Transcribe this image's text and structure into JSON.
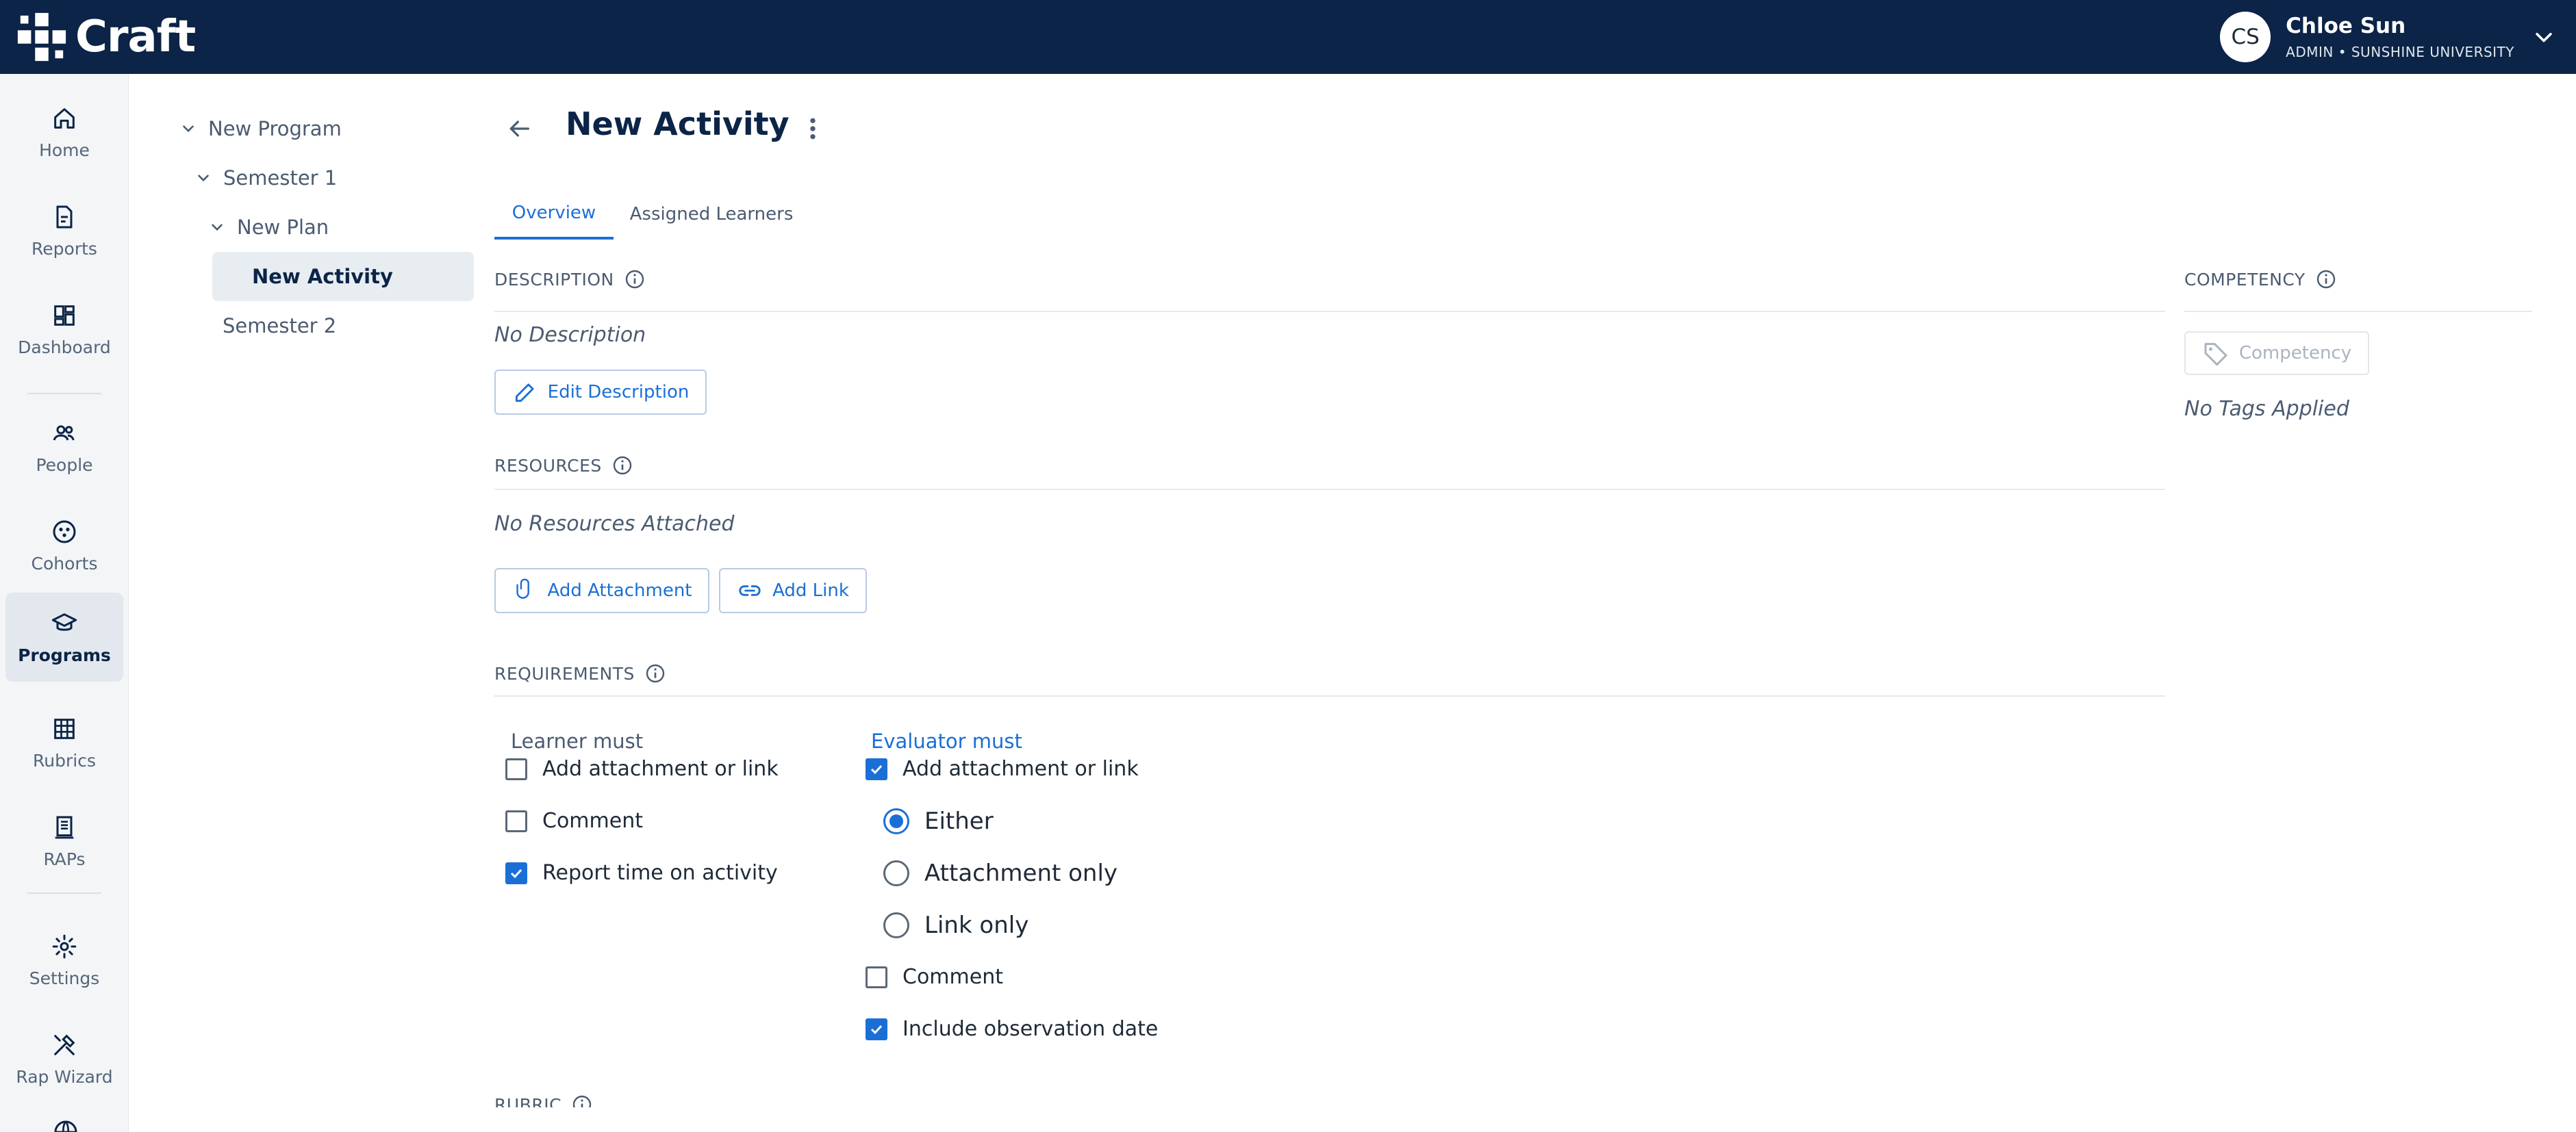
{
  "app": {
    "name": "Craft"
  },
  "user": {
    "initials": "CS",
    "name": "Chloe Sun",
    "role": "ADMIN • SUNSHINE UNIVERSITY"
  },
  "nav": {
    "items": [
      {
        "label": "Home",
        "icon": "home-icon"
      },
      {
        "label": "Reports",
        "icon": "reports-icon"
      },
      {
        "label": "Dashboard",
        "icon": "dashboard-icon"
      },
      {
        "label": "People",
        "icon": "people-icon"
      },
      {
        "label": "Cohorts",
        "icon": "cohorts-icon"
      },
      {
        "label": "Programs",
        "icon": "programs-icon",
        "active": true
      },
      {
        "label": "Rubrics",
        "icon": "rubrics-icon"
      },
      {
        "label": "RAPs",
        "icon": "raps-icon"
      },
      {
        "label": "Settings",
        "icon": "settings-icon"
      },
      {
        "label": "Rap Wizard",
        "icon": "rap-wizard-icon"
      }
    ]
  },
  "tree": {
    "items": [
      {
        "label": "New Program",
        "expanded": true
      },
      {
        "label": "Semester 1",
        "expanded": true
      },
      {
        "label": "New Plan",
        "expanded": true
      },
      {
        "label": "New Activity",
        "selected": true
      },
      {
        "label": "Semester 2"
      }
    ]
  },
  "page": {
    "title": "New Activity"
  },
  "tabs": [
    {
      "label": "Overview",
      "active": true
    },
    {
      "label": "Assigned Learners"
    }
  ],
  "description": {
    "heading": "DESCRIPTION",
    "empty_text": "No Description",
    "edit_button": "Edit Description"
  },
  "resources": {
    "heading": "RESOURCES",
    "empty_text": "No Resources Attached",
    "add_attachment_button": "Add Attachment",
    "add_link_button": "Add Link"
  },
  "requirements": {
    "heading": "REQUIREMENTS",
    "learner": {
      "label": "Learner must",
      "options": [
        {
          "label": "Add attachment or link",
          "checked": false
        },
        {
          "label": "Comment",
          "checked": false
        },
        {
          "label": "Report time on activity",
          "checked": true
        }
      ]
    },
    "evaluator": {
      "label": "Evaluator must",
      "attachment": {
        "label": "Add attachment or link",
        "checked": true
      },
      "radios": [
        {
          "label": "Either",
          "selected": true
        },
        {
          "label": "Attachment only",
          "selected": false
        },
        {
          "label": "Link only",
          "selected": false
        }
      ],
      "comment": {
        "label": "Comment",
        "checked": false
      },
      "observation": {
        "label": "Include observation date",
        "checked": true
      }
    }
  },
  "rubric": {
    "heading": "RUBRIC"
  },
  "competency": {
    "heading": "COMPETENCY",
    "tag_placeholder": "Competency",
    "empty_text": "No Tags Applied"
  },
  "colors": {
    "topbar": "#0b2447",
    "accent": "#1a6fd6"
  }
}
